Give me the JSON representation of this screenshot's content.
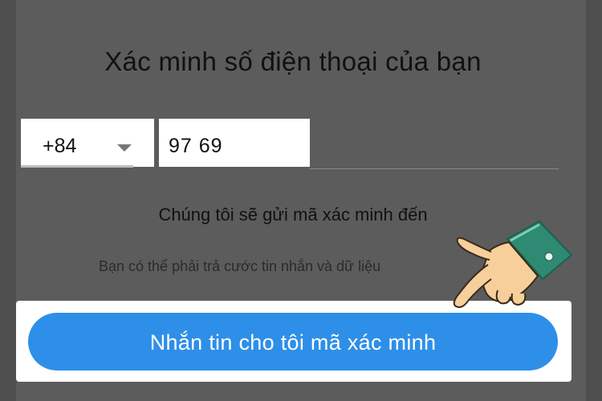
{
  "header": {
    "title": "Xác minh số điện thoại của bạn"
  },
  "phone": {
    "country_code": "+84",
    "number": "97 69"
  },
  "info": {
    "send_text": "Chúng tôi sẽ gửi mã xác minh đến",
    "rates_text": "Bạn có thể phải trả cước tin nhắn và dữ liệu"
  },
  "action": {
    "button_label": "Nhắn tin cho tôi mã xác minh"
  },
  "icons": {
    "dropdown": "chevron-down-icon",
    "pointer": "pointing-hand-icon"
  },
  "colors": {
    "primary": "#2e8fe8",
    "background": "#5c5c5c",
    "hand_skin": "#f6cf9b",
    "cuff": "#2e8a72"
  }
}
